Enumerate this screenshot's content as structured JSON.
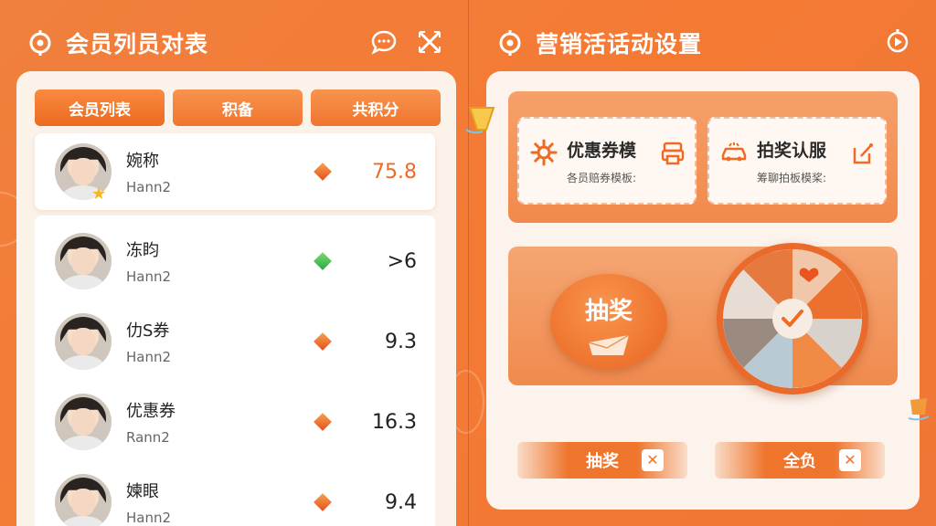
{
  "left_panel": {
    "title": "会员列员对表",
    "tabs": [
      {
        "label": "会员列表"
      },
      {
        "label": "积备"
      },
      {
        "label": "共积分"
      }
    ],
    "members": [
      {
        "name": "婉称",
        "sub": "Hann2",
        "score": "75.8",
        "gem": "orange"
      },
      {
        "name": "冻盷",
        "sub": "Hann2",
        "score": ">6",
        "gem": "green"
      },
      {
        "name": "仂S券",
        "sub": "Hann2",
        "score": "9.3",
        "gem": "orange"
      },
      {
        "name": "优惠券",
        "sub": "Rann2",
        "score": "16.3",
        "gem": "orange"
      },
      {
        "name": "媡眼",
        "sub": "Hann2",
        "score": "9.4",
        "gem": "orange"
      }
    ]
  },
  "right_panel": {
    "title": "营销活话动设置",
    "coupons": [
      {
        "title": "优惠券模",
        "sub": "各员赔券模板:"
      },
      {
        "title": "拍奖认服",
        "sub": "筹聊拍板模桨:"
      }
    ],
    "draw_label": "抽奖",
    "buttons": [
      {
        "label": "抽奖",
        "close": "✕"
      },
      {
        "label": "全负",
        "close": "✕"
      }
    ]
  },
  "colors": {
    "accent": "#ef752d",
    "background": "#f47a34",
    "card": "#fbf2ea"
  }
}
